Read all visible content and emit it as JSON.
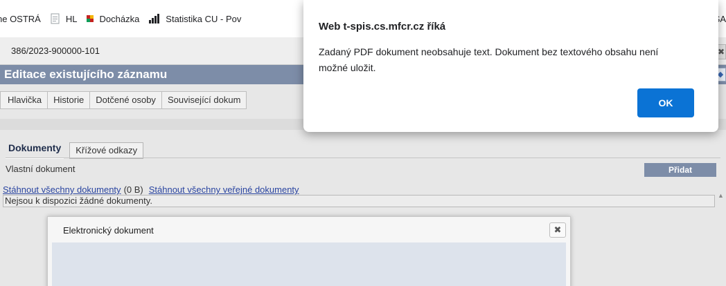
{
  "bookmarks": {
    "items": [
      {
        "label": "ne OSTRÁ",
        "icon": "none"
      },
      {
        "label": "HL",
        "icon": "document-icon"
      },
      {
        "label": "Docházka",
        "icon": "app-icon"
      },
      {
        "label": "Statistika CU - Pov",
        "icon": "bar-chart-icon"
      }
    ],
    "right_label": "SA"
  },
  "page": {
    "doc_id": "386/2023-900000-101",
    "edit_title": "Editace existujícího záznamu",
    "tabs": [
      "Hlavička",
      "Historie",
      "Dotčené osoby",
      "Související dokum"
    ],
    "subtabs": {
      "active": "Dokumenty",
      "other": "Křížové odkazy"
    },
    "vlastni_label": "Vlastní dokument",
    "pridat_label": "Přidat",
    "download_all": "Stáhnout všechny dokumenty",
    "download_size": "(0 B)",
    "download_public": "Stáhnout všechny veřejné dokumenty",
    "empty_message": "Nejsou k dispozici žádné dokumenty."
  },
  "edoc_modal": {
    "title": "Elektronický dokument",
    "close_glyph": "✖"
  },
  "alert": {
    "title": "Web t-spis.cs.mfcr.cz říká",
    "message": "Zadaný PDF dokument neobsahuje text. Dokument bez textového obsahu není možné uložit.",
    "ok_label": "OK",
    "accent": "#0b73d5"
  }
}
